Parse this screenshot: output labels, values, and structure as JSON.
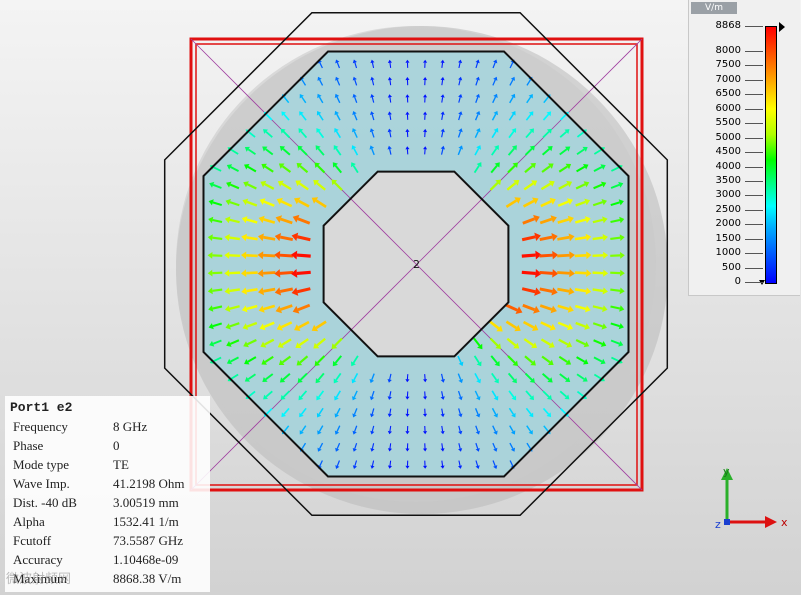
{
  "port": {
    "title": "Port1 e2",
    "rows": [
      {
        "key": "Frequency",
        "value": "8 GHz"
      },
      {
        "key": "Phase",
        "value": "0"
      },
      {
        "key": "Mode type",
        "value": "TE"
      },
      {
        "key": "Wave Imp.",
        "value": "41.2198 Ohm"
      },
      {
        "key": "Dist. -40 dB",
        "value": "3.00519 mm"
      },
      {
        "key": "Alpha",
        "value": "1532.41 1/m"
      },
      {
        "key": "Fcutoff",
        "value": "73.5587 GHz"
      },
      {
        "key": "Accuracy",
        "value": "1.10468e-09"
      },
      {
        "key": "Maximum",
        "value": "8868.38 V/m"
      }
    ]
  },
  "legend": {
    "unit": "V/m",
    "ticks": [
      "8868",
      "8000",
      "7500",
      "7000",
      "6500",
      "6000",
      "5500",
      "5000",
      "4500",
      "4000",
      "3500",
      "3000",
      "2500",
      "2000",
      "1500",
      "1000",
      "500",
      "0"
    ],
    "max": 8868
  },
  "center_label": "2",
  "axes": {
    "x": "x",
    "y": "y",
    "z": "z"
  },
  "watermark": "微波射频网",
  "colors": {
    "port_frame": "#e01010",
    "dielectric": "#9fd6df",
    "outline": "#111111"
  }
}
